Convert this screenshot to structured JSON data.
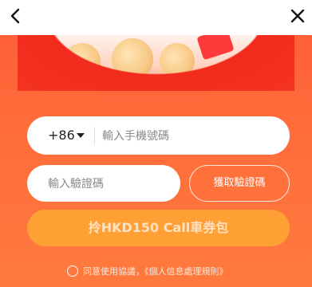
{
  "nav": {
    "back_icon": "chevron-left-icon",
    "close_icon": "close-icon"
  },
  "form": {
    "country_code": "+86",
    "phone_placeholder": "輸入手機號碼",
    "code_placeholder": "輸入驗證碼",
    "get_code_label": "獲取驗證碼",
    "submit_label": "拎HKD150 Call車券包",
    "agreement_text": "同意使用協議，《個人信息處理規則》"
  },
  "colors": {
    "background": "#ff6a3b",
    "cta": "#ffa035",
    "banner_red": "#f22b1c"
  }
}
